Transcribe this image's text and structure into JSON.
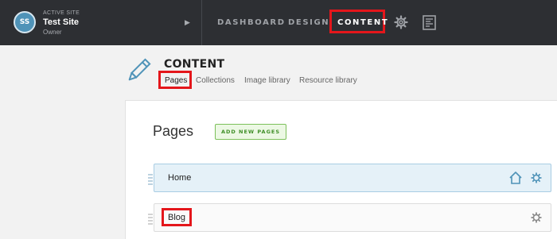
{
  "topbar": {
    "site": {
      "label": "ACTIVE SITE",
      "avatar_initials": "SS",
      "name": "Test Site",
      "role": "Owner"
    },
    "nav": {
      "dashboard": "DASHBOARD",
      "design": "DESIGN",
      "content": "CONTENT"
    },
    "icons": [
      "gear-icon",
      "document-icon"
    ]
  },
  "header": {
    "title": "CONTENT",
    "subnav": {
      "pages": "Pages",
      "collections": "Collections",
      "image_library": "Image library",
      "resource_library": "Resource library"
    }
  },
  "main": {
    "title": "Pages",
    "add_button": "ADD NEW PAGES",
    "rows": [
      {
        "label": "Home",
        "is_home": true
      },
      {
        "label": "Blog",
        "is_home": false
      }
    ]
  },
  "colors": {
    "topbar": "#2d2f33",
    "accent_blue": "#4f93b8",
    "highlight_red": "#e4161b",
    "add_green": "#3f8f27"
  }
}
